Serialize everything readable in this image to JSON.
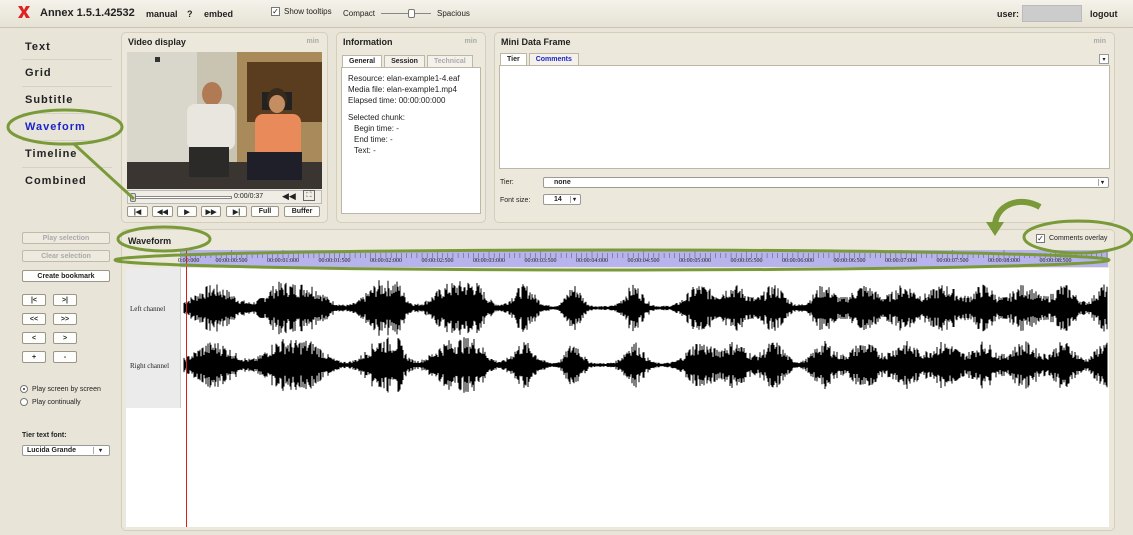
{
  "topbar": {
    "app_title": "Annex 1.5.1.42532",
    "manual": "manual",
    "help": "?",
    "embed": "embed",
    "show_tooltips": "Show tooltips",
    "compact": "Compact",
    "spacious": "Spacious",
    "user_label": "user:",
    "logout": "logout"
  },
  "nav": {
    "items": [
      "Text",
      "Grid",
      "Subtitle",
      "Waveform",
      "Timeline",
      "Combined"
    ],
    "active": "Waveform"
  },
  "video": {
    "title": "Video display",
    "min": "min",
    "time": "0:00/0:37",
    "buttons": [
      "|◀",
      "◀◀",
      "▶",
      "▶▶",
      "▶|",
      "Full",
      "Buffer"
    ]
  },
  "information": {
    "title": "Information",
    "min": "min",
    "tabs": [
      "General",
      "Session",
      "Technical"
    ],
    "resource": "Resource:  elan-example1-4.eaf",
    "media_file": "Media file:  elan-example1.mp4",
    "elapsed": "Elapsed time:      00:00:00:000",
    "selected_chunk": "Selected chunk:",
    "begin_time": "Begin time:      -",
    "end_time": "End time:        -",
    "text": "Text:     -"
  },
  "mini_data_frame": {
    "title": "Mini Data Frame",
    "min": "min",
    "tabs": [
      "Tier",
      "Comments"
    ],
    "tier_label": "Tier:",
    "tier_value": "none",
    "font_size_label": "Font size:",
    "font_size_value": "14"
  },
  "left_controls": {
    "play_selection": "Play selection",
    "clear_selection": "Clear selection",
    "create_bookmark": "Create bookmark",
    "nav_buttons": [
      "|<",
      ">|",
      "<<",
      ">>",
      "<",
      ">",
      "+",
      "-"
    ],
    "play_screen": "Play screen by screen",
    "play_continually": "Play continually",
    "tier_font_label": "Tier text font:",
    "tier_font_value": "Lucida Grande"
  },
  "waveform": {
    "title": "Waveform",
    "comments_overlay": "Comments overlay",
    "left_channel": "Left channel",
    "right_channel": "Right channel",
    "ruler_labels": [
      "0:00:000",
      "00:00:00:500",
      "00:00:01:000",
      "00:00:01:500",
      "00:00:02:000",
      "00:00:02:500",
      "00:00:03:000",
      "00:00:03:500",
      "00:00:04:000",
      "00:00:04:500",
      "00:00:05:000",
      "00:00:05:500",
      "00:00:06:000",
      "00:00:06:500",
      "00:00:07:000",
      "00:00:07:500",
      "00:00:08:000",
      "00:00:08:500"
    ]
  },
  "colors": {
    "accent_nav": "#1a25c8",
    "annotation_green": "#7a9a3a",
    "ruler": "#b7b3ec",
    "playhead": "#d61f1f"
  }
}
